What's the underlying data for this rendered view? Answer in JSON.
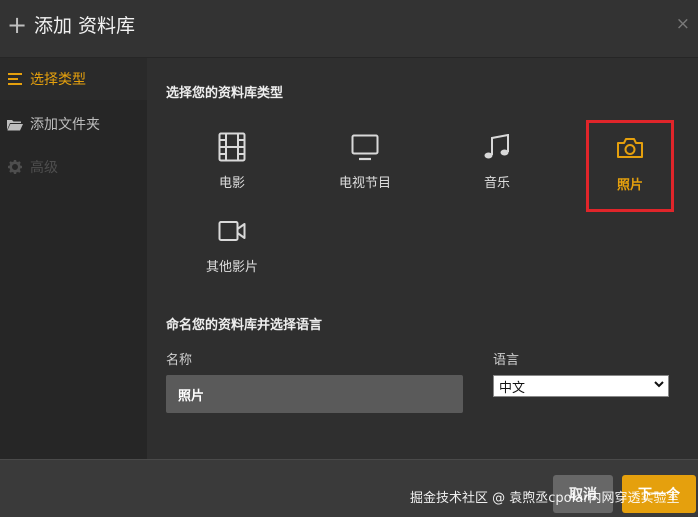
{
  "header": {
    "plus_glyph": "+",
    "title": "添加 资料库",
    "close_glyph": "×"
  },
  "sidebar": {
    "items": [
      {
        "label": "选择类型",
        "icon": "list-icon",
        "state": "active"
      },
      {
        "label": "添加文件夹",
        "icon": "folder-icon",
        "state": "normal"
      },
      {
        "label": "高级",
        "icon": "gear-icon",
        "state": "disabled"
      }
    ]
  },
  "main": {
    "type_section_title": "选择您的资料库类型",
    "types": [
      {
        "label": "电影",
        "icon": "film-icon"
      },
      {
        "label": "电视节目",
        "icon": "tv-icon"
      },
      {
        "label": "音乐",
        "icon": "music-note-icon"
      },
      {
        "label": "照片",
        "icon": "camera-icon",
        "selected": true
      },
      {
        "label": "其他影片",
        "icon": "video-camera-icon"
      }
    ],
    "name_section_title": "命名您的资料库并选择语言",
    "name_label": "名称",
    "name_value": "照片",
    "language_label": "语言",
    "language_value": "中文"
  },
  "footer": {
    "cancel_label": "取消",
    "next_label": "下一个",
    "watermark": "掘金技术社区 @ 袁煦丞cpolar内网穿透实验室"
  },
  "colors": {
    "accent": "#e5a00d",
    "highlight_border": "#e0252a",
    "background": "#2f2f2f",
    "sidebar": "#262626"
  }
}
